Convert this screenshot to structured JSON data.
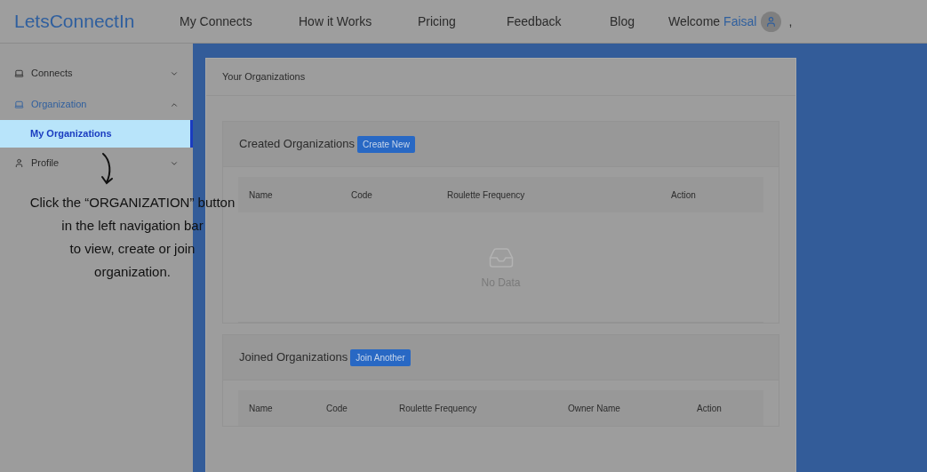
{
  "header": {
    "logo": "LetsConnectIn",
    "nav": [
      {
        "label": "My Connects"
      },
      {
        "label": "How it Works"
      },
      {
        "label": "Pricing"
      },
      {
        "label": "Feedback"
      },
      {
        "label": "Blog"
      }
    ],
    "welcome": "Welcome",
    "user_name": "Faisal",
    "trailing": ","
  },
  "sidebar": {
    "items": [
      {
        "label": "Connects",
        "expanded": false
      },
      {
        "label": "Organization",
        "expanded": true,
        "children": [
          {
            "label": "My Organizations",
            "selected": true
          }
        ]
      },
      {
        "label": "Profile",
        "expanded": false
      }
    ]
  },
  "card": {
    "title": "Your Organizations",
    "sections": [
      {
        "title": "Created Organizations",
        "button": "Create New",
        "columns": [
          "Name",
          "Code",
          "Roulette Frequency",
          "Action"
        ],
        "empty_text": "No Data"
      },
      {
        "title": "Joined Organizations",
        "button": "Join Another",
        "columns": [
          "Name",
          "Code",
          "Roulette Frequency",
          "Owner Name",
          "Action"
        ]
      }
    ]
  },
  "annotation": {
    "lines": [
      "Click the “ORGANIZATION” button",
      "in the left navigation bar",
      "to view, create or join",
      "organization."
    ]
  }
}
